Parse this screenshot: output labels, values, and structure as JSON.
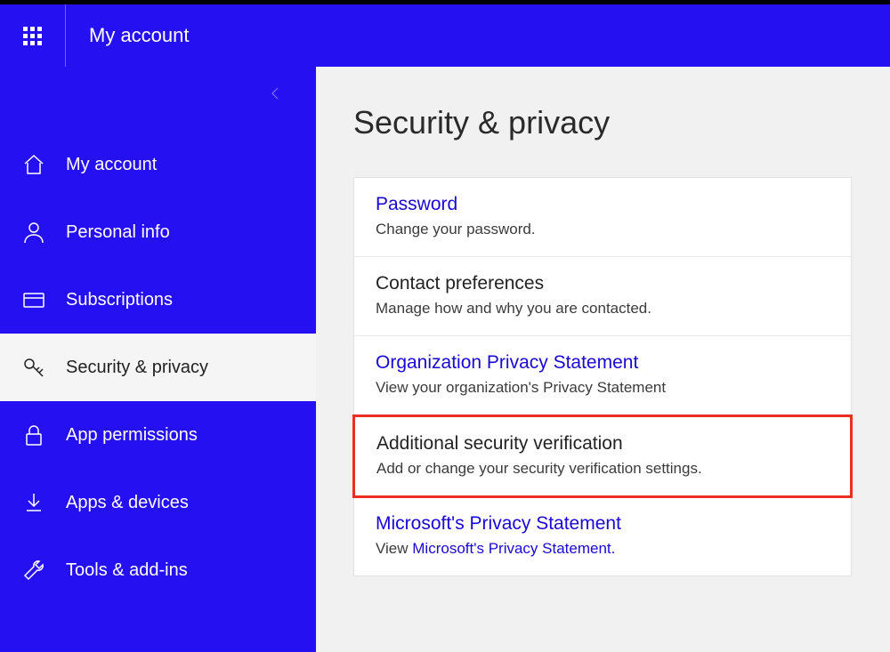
{
  "header": {
    "title": "My account"
  },
  "sidebar": {
    "items": [
      {
        "label": "My account"
      },
      {
        "label": "Personal info"
      },
      {
        "label": "Subscriptions"
      },
      {
        "label": "Security & privacy"
      },
      {
        "label": "App permissions"
      },
      {
        "label": "Apps & devices"
      },
      {
        "label": "Tools & add-ins"
      }
    ]
  },
  "main": {
    "title": "Security & privacy",
    "items": [
      {
        "title": "Password",
        "title_is_link": true,
        "desc_prefix": "Change your password.",
        "desc_link": "",
        "highlight": false
      },
      {
        "title": "Contact preferences",
        "title_is_link": false,
        "desc_prefix": "Manage how and why you are contacted.",
        "desc_link": "",
        "highlight": false
      },
      {
        "title": "Organization Privacy Statement",
        "title_is_link": true,
        "desc_prefix": "View your organization's Privacy Statement",
        "desc_link": "",
        "highlight": false
      },
      {
        "title": "Additional security verification",
        "title_is_link": false,
        "desc_prefix": "Add or change your security verification settings.",
        "desc_link": "",
        "highlight": true
      },
      {
        "title": "Microsoft's Privacy Statement",
        "title_is_link": true,
        "desc_prefix": "View ",
        "desc_link": "Microsoft's Privacy Statement.",
        "highlight": false
      }
    ]
  }
}
